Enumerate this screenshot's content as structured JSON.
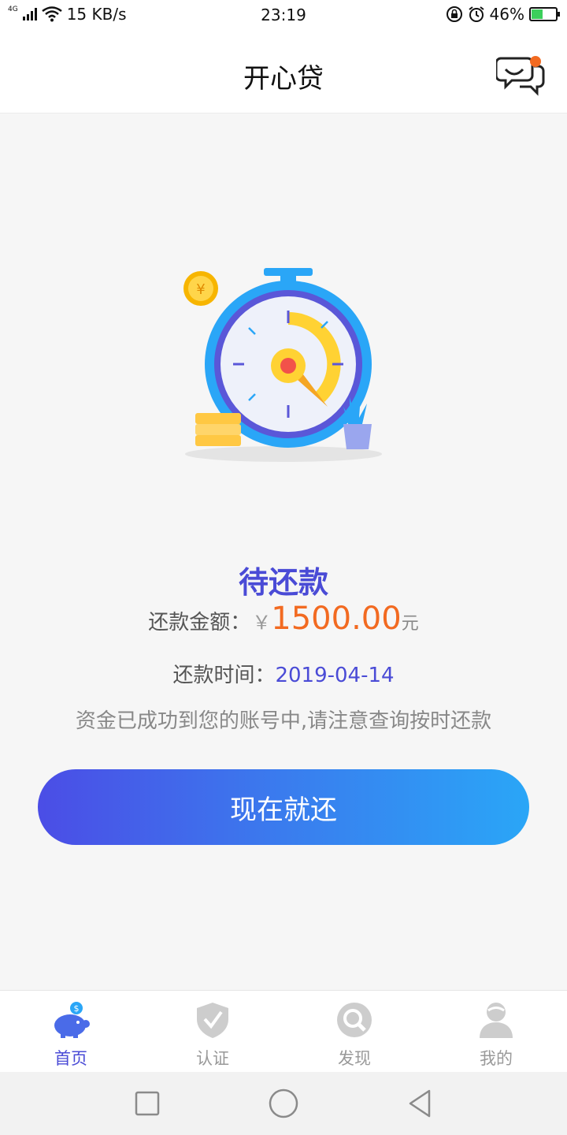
{
  "status_bar": {
    "network_type": "4G",
    "speed": "15 KB/s",
    "time": "23:19",
    "battery": "46%",
    "battery_level": 0.46
  },
  "header": {
    "title": "开心贷",
    "chat_icon": "chat-bubbles-icon",
    "has_notification_dot": true
  },
  "main": {
    "status_title": "待还款",
    "amount_label": "还款金额：",
    "currency_symbol": "￥",
    "amount": "1500.00",
    "amount_unit": "元",
    "date_label": "还款时间：",
    "date": "2019-04-14",
    "notice": "资金已成功到您的账号中,请注意查询按时还款",
    "button_label": "现在就还"
  },
  "tabs": [
    {
      "label": "首页",
      "icon": "piggy-bank-icon",
      "active": true
    },
    {
      "label": "认证",
      "icon": "shield-check-icon",
      "active": false
    },
    {
      "label": "发现",
      "icon": "discover-search-icon",
      "active": false
    },
    {
      "label": "我的",
      "icon": "user-icon",
      "active": false
    }
  ],
  "colors": {
    "accent": "#4a4bd6",
    "amount": "#f26a21",
    "button_start": "#4b4de6",
    "button_end": "#2aa6f7",
    "inactive": "#c9c9c9"
  }
}
